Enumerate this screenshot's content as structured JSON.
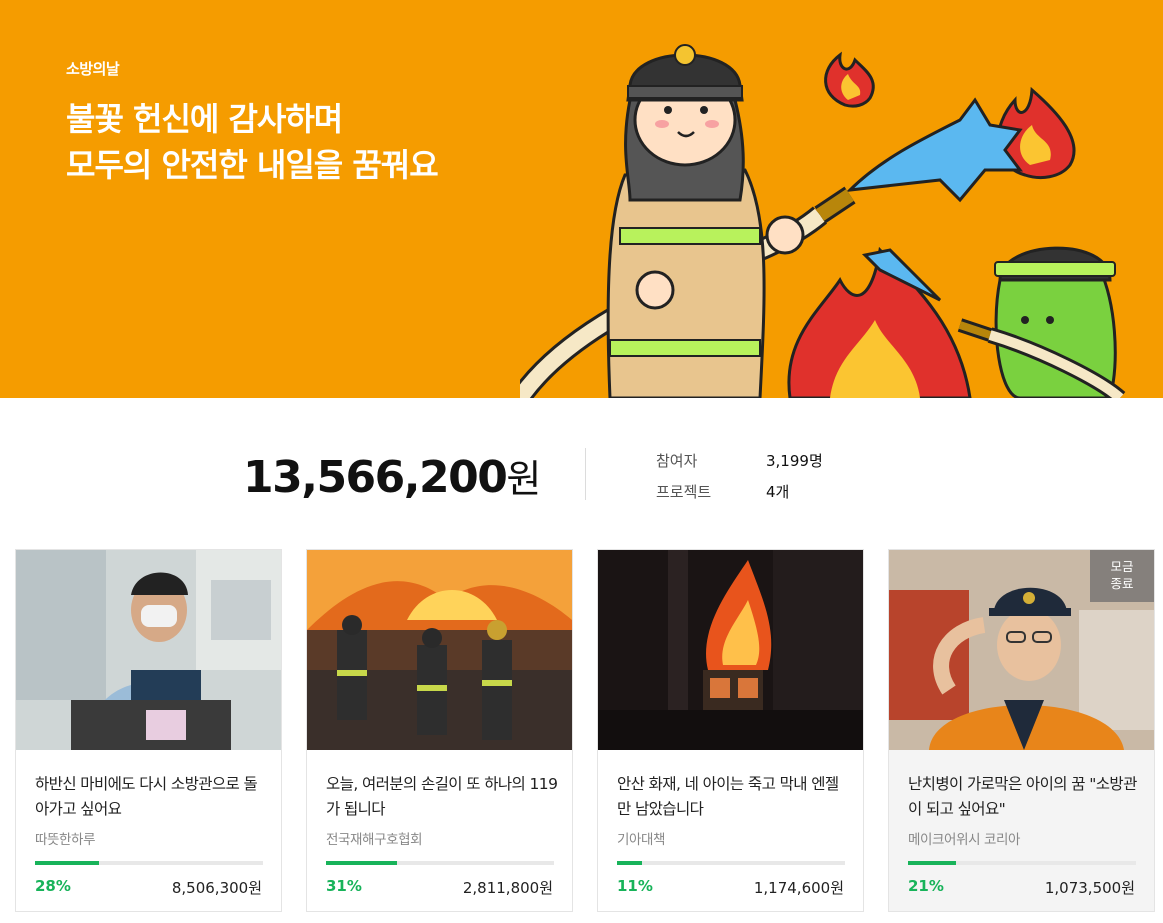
{
  "hero": {
    "tag": "소방의날",
    "title_line1": "불꽃 헌신에 감사하며",
    "title_line2": "모두의 안전한 내일을 꿈꿔요"
  },
  "summary": {
    "total_amount": "13,566,200",
    "total_unit": "원",
    "participants_label": "참여자",
    "participants_value": "3,199명",
    "projects_label": "프로젝트",
    "projects_value": "4개"
  },
  "cards": [
    {
      "title": "하반신 마비에도 다시 소방관으로 돌아가고 싶어요",
      "org": "따뜻한하루",
      "percent_label": "28%",
      "progress": 0.28,
      "amount": "8,506,300원",
      "ended": false
    },
    {
      "title": "오늘, 여러분의 손길이 또 하나의 119가 됩니다",
      "org": "전국재해구호협회",
      "percent_label": "31%",
      "progress": 0.31,
      "amount": "2,811,800원",
      "ended": false
    },
    {
      "title": "안산 화재, 네 아이는 죽고 막내 엔젤만 남았습니다",
      "org": "기아대책",
      "percent_label": "11%",
      "progress": 0.11,
      "amount": "1,174,600원",
      "ended": false
    },
    {
      "title": "난치병이 가로막은 아이의 꿈 \"소방관이 되고 싶어요\"",
      "org": "메이크어위시 코리아",
      "percent_label": "21%",
      "progress": 0.21,
      "amount": "1,073,500원",
      "ended": true,
      "badge_line1": "모금",
      "badge_line2": "종료"
    }
  ],
  "colors": {
    "hero_bg": "#f59c00",
    "progress": "#18b35a"
  }
}
